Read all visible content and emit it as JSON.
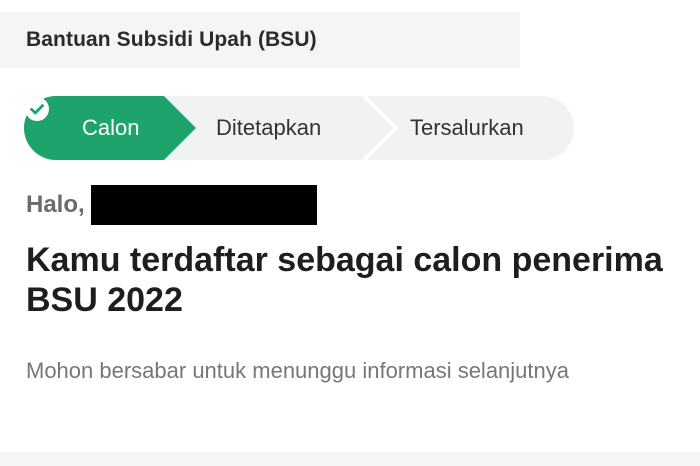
{
  "header": {
    "title": "Bantuan Subsidi Upah (BSU)"
  },
  "stepper": {
    "steps": [
      {
        "label": "Calon",
        "status": "active",
        "icon": "check-circle-icon"
      },
      {
        "label": "Ditetapkan",
        "status": "pending"
      },
      {
        "label": "Tersalurkan",
        "status": "pending"
      }
    ]
  },
  "main": {
    "greeting": "Halo,",
    "headline": "Kamu terdaftar sebagai calon penerima BSU 2022",
    "description": "Mohon bersabar untuk menunggu informasi selanjutnya"
  },
  "colors": {
    "accent": "#1fa36c",
    "step_inactive": "#f1f2f4",
    "step_separator": "#ffffff",
    "heading": "#1e1e1e",
    "muted": "#777777"
  }
}
